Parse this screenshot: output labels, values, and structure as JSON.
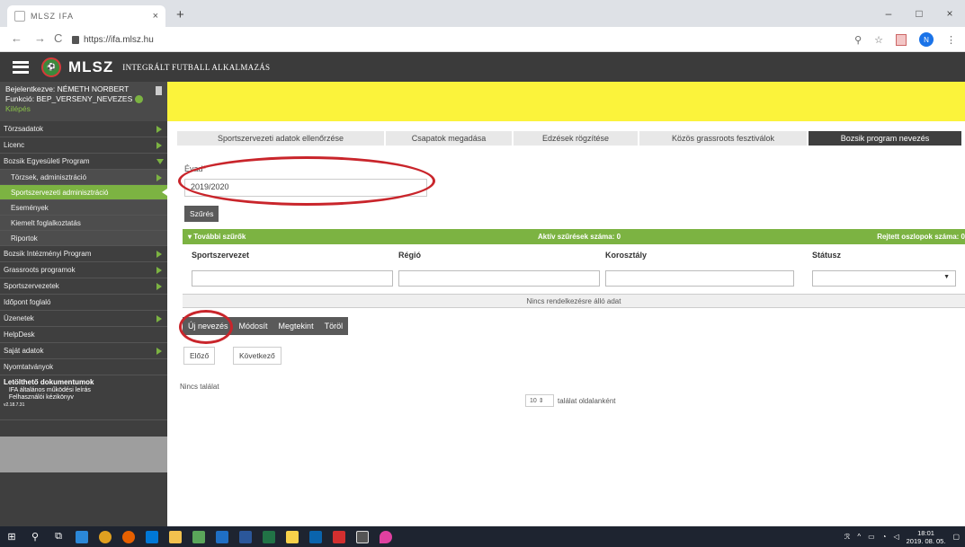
{
  "browser": {
    "tab_title": "MLSZ IFA",
    "tab_close": "×",
    "new_tab": "+",
    "url": "https://ifa.mlsz.hu",
    "nav_back": "←",
    "nav_forward": "→",
    "nav_reload": "C",
    "avatar_letter": "N",
    "win_min": "–",
    "win_max": "□",
    "win_close": "×"
  },
  "app": {
    "brand": "MLSZ",
    "name": "INTEGRÁLT FUTBALL ALKALMAZÁS",
    "accent": "#7cb342"
  },
  "user": {
    "logged_in": "Bejelentkezve: NÉMETH NORBERT",
    "function": "Funkció: BEP_VERSENY_NEVEZES",
    "logout": "Kilépés"
  },
  "sidebar": {
    "items": [
      {
        "label": "Törzsadatok"
      },
      {
        "label": "Licenc"
      },
      {
        "label": "Bozsik Egyesületi Program"
      },
      {
        "label": "Törzsek, adminisztráció"
      },
      {
        "label": "Sportszervezeti adminisztráció"
      },
      {
        "label": "Események"
      },
      {
        "label": "Kiemelt foglalkoztatás"
      },
      {
        "label": "Riportok"
      },
      {
        "label": "Bozsik Intézményi Program"
      },
      {
        "label": "Grassroots programok"
      },
      {
        "label": "Sportszervezetek"
      },
      {
        "label": "Időpont foglaló"
      },
      {
        "label": "Üzenetek"
      },
      {
        "label": "HelpDesk"
      },
      {
        "label": "Saját adatok"
      },
      {
        "label": "Nyomtatványok"
      }
    ],
    "docs_title": "Letölthető dokumentumok",
    "docs_1": "IFA általános működési leírás",
    "docs_2": "Felhasználói kézikönyv",
    "version": "v2.18.7.31"
  },
  "tabs": [
    {
      "label": "Sportszervezeti adatok ellenőrzése"
    },
    {
      "label": "Csapatok megadása"
    },
    {
      "label": "Edzések rögzítése"
    },
    {
      "label": "Közös grassroots fesztiválok"
    },
    {
      "label": "Bozsik program nevezés"
    }
  ],
  "form": {
    "evad_label": "Évad",
    "evad_required": "*",
    "evad_value": "2019/2020",
    "filter_button": "Szűrés"
  },
  "filterbar": {
    "more": "▾ További szűrők",
    "active": "Aktív szűrések száma: 0",
    "hidden": "Rejtett oszlopok száma: 0"
  },
  "table": {
    "columns": [
      "Sportszervezet",
      "Régió",
      "Korosztály",
      "Státusz"
    ],
    "no_data": "Nincs rendelkezésre álló adat"
  },
  "actions": {
    "new": "Új nevezés",
    "modify": "Módosít",
    "view": "Megtekint",
    "delete": "Töröl"
  },
  "pager": {
    "prev": "Előző",
    "next": "Következő",
    "no_results": "Nincs találat",
    "per_page_value": "10",
    "per_page_text": "találat oldalanként"
  },
  "taskbar": {
    "time": "18:01",
    "date": "2019. 08. 05."
  }
}
